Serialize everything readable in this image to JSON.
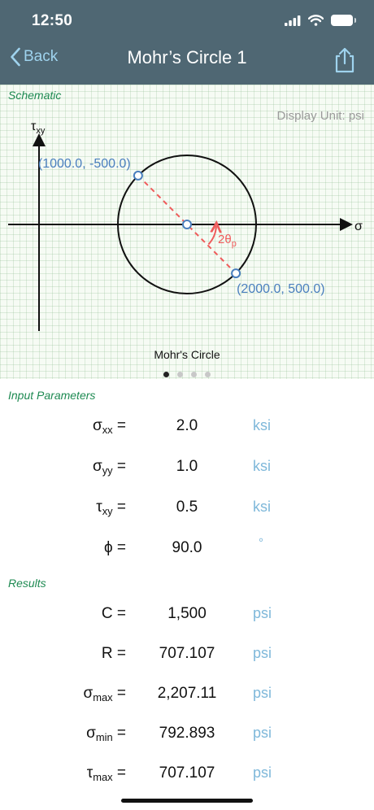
{
  "status": {
    "time": "12:50"
  },
  "nav": {
    "back_label": "Back",
    "title": "Mohr’s Circle 1"
  },
  "schematic": {
    "section_label": "Schematic",
    "display_unit": "Display Unit: psi",
    "chart_title": "Mohr's Circle",
    "page_count": 4,
    "active_page": 0
  },
  "chart_data": {
    "type": "scatter",
    "title": "Mohr's Circle",
    "xlabel": "σ",
    "ylabel": "τ",
    "ylabel_sub": "xy",
    "center": [
      1500,
      0
    ],
    "radius": 707.107,
    "points": [
      {
        "x": 1000.0,
        "y": -500.0,
        "label": "(1000.0, -500.0)"
      },
      {
        "x": 2000.0,
        "y": 500.0,
        "label": "(2000.0, 500.0)"
      }
    ],
    "angle_label": "2θ",
    "angle_label_sub": "p",
    "colors": {
      "circle": "#111111",
      "points": "#4a7fbe",
      "diameter": "#ef5b5b"
    }
  },
  "inputs": {
    "section_label": "Input Parameters",
    "rows": [
      {
        "sym": "σ",
        "sub": "xx",
        "value": "2.0",
        "unit": "ksi"
      },
      {
        "sym": "σ",
        "sub": "yy",
        "value": "1.0",
        "unit": "ksi"
      },
      {
        "sym": "τ",
        "sub": "xy",
        "value": "0.5",
        "unit": "ksi"
      },
      {
        "sym": "ϕ",
        "sub": "",
        "value": "90.0",
        "unit": "°"
      }
    ]
  },
  "results": {
    "section_label": "Results",
    "rows": [
      {
        "sym": "C",
        "sub": "",
        "value": "1,500",
        "unit": "psi"
      },
      {
        "sym": "R",
        "sub": "",
        "value": "707.107",
        "unit": "psi"
      },
      {
        "sym": "σ",
        "sub": "max",
        "value": "2,207.11",
        "unit": "psi"
      },
      {
        "sym": "σ",
        "sub": "min",
        "value": "792.893",
        "unit": "psi"
      },
      {
        "sym": "τ",
        "sub": "max",
        "value": "707.107",
        "unit": "psi"
      }
    ]
  }
}
